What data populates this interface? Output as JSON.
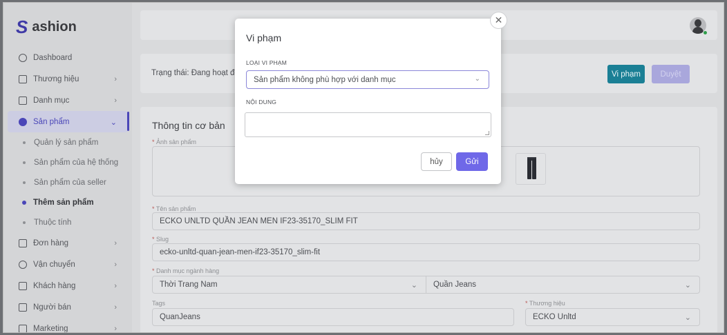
{
  "brand": {
    "mark": "S",
    "name": "ashion"
  },
  "sidebar": {
    "items": [
      {
        "label": "Dashboard"
      },
      {
        "label": "Thương hiệu"
      },
      {
        "label": "Danh mục"
      },
      {
        "label": "Sản phẩm"
      }
    ],
    "sub_items": [
      {
        "label": "Quản lý sản phẩm"
      },
      {
        "label": "Sản phẩm của hệ thống"
      },
      {
        "label": "Sản phẩm của seller"
      },
      {
        "label": "Thêm sản phẩm"
      },
      {
        "label": "Thuộc tính"
      }
    ],
    "items_after": [
      {
        "label": "Đơn hàng"
      },
      {
        "label": "Vận chuyển"
      },
      {
        "label": "Khách hàng"
      },
      {
        "label": "Người bán"
      },
      {
        "label": "Marketing"
      }
    ]
  },
  "status": {
    "text": "Trạng thái: Đang hoạt động",
    "violation_label": "Vi phạm",
    "approve_label": "Duyệt"
  },
  "basic_info": {
    "title": "Thông tin cơ bản",
    "image_label": "Ảnh sản phẩm",
    "name_label": "Tên sản phẩm",
    "name_value": "ECKO UNLTD QUẦN JEAN MEN IF23-35170_SLIM FIT",
    "slug_label": "Slug",
    "slug_value": "ecko-unltd-quan-jean-men-if23-35170_slim-fit",
    "category_label": "Danh mục ngành hàng",
    "category_value": "Thời Trang Nam",
    "subcategory_value": "Quần Jeans",
    "tags_label": "Tags",
    "tags_value": "QuanJeans",
    "brand_label": "Thương hiệu",
    "brand_value": "ECKO Unltd"
  },
  "modal": {
    "title": "Vi phạm",
    "type_label": "LOẠI VI PHẠM",
    "type_value": "Sản phẩm không phù hợp với danh mục",
    "content_label": "NỘI DUNG",
    "content_value": "",
    "cancel_label": "hủy",
    "send_label": "Gửi"
  }
}
